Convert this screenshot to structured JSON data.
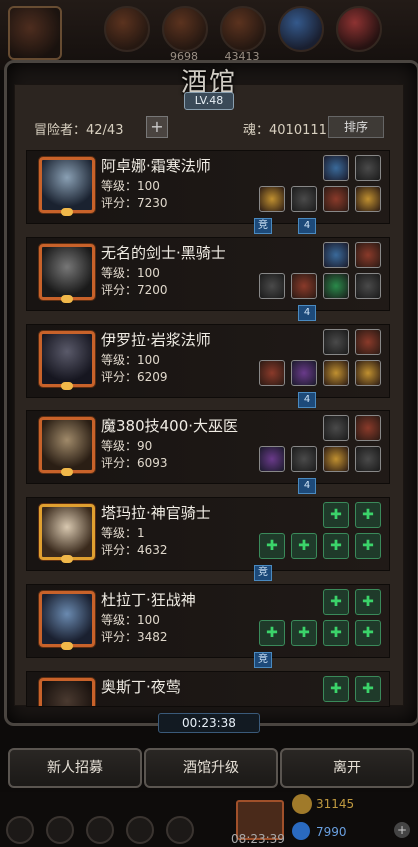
{
  "top_stats": [
    "9698",
    "43413"
  ],
  "title": "酒馆",
  "level_badge": "LV.48",
  "adventurers_text": "冒险者：42/43",
  "plus_label": "+",
  "soul_text": "魂：4010111",
  "sort_label": "排序",
  "heroes": [
    {
      "name": "阿卓娜·霜寒法师",
      "level": "等级：100",
      "score": "评分：7230",
      "tags": [
        "竞",
        "4"
      ]
    },
    {
      "name": "无名的剑士·黑骑士",
      "level": "等级：100",
      "score": "评分：7200",
      "tags": [
        "4"
      ]
    },
    {
      "name": "伊罗拉·岩浆法师",
      "level": "等级：100",
      "score": "评分：6209",
      "tags": [
        "4"
      ]
    },
    {
      "name": "魔380技400·大巫医",
      "level": "等级：90",
      "score": "评分：6093",
      "tags": [
        "4"
      ]
    },
    {
      "name": "塔玛拉·神官骑士",
      "level": "等级：1",
      "score": "评分：4632",
      "tags": [
        "竞"
      ]
    },
    {
      "name": "杜拉丁·狂战神",
      "level": "等级：100",
      "score": "评分：3482",
      "tags": [
        "竞"
      ]
    },
    {
      "name": "奥斯丁·夜莺",
      "level": "",
      "score": "",
      "tags": []
    }
  ],
  "timer": "00:23:38",
  "buttons": {
    "recruit": "新人招募",
    "upgrade": "酒馆升级",
    "leave": "离开"
  },
  "bottom": {
    "chest_time": "08:23:39",
    "gold": "31145",
    "gems": "7990",
    "plus": "+"
  },
  "colors": {
    "accent_orange": "#c8622a",
    "equip_green": "#3bd46a",
    "tag_blue": "#1d4a7a"
  }
}
